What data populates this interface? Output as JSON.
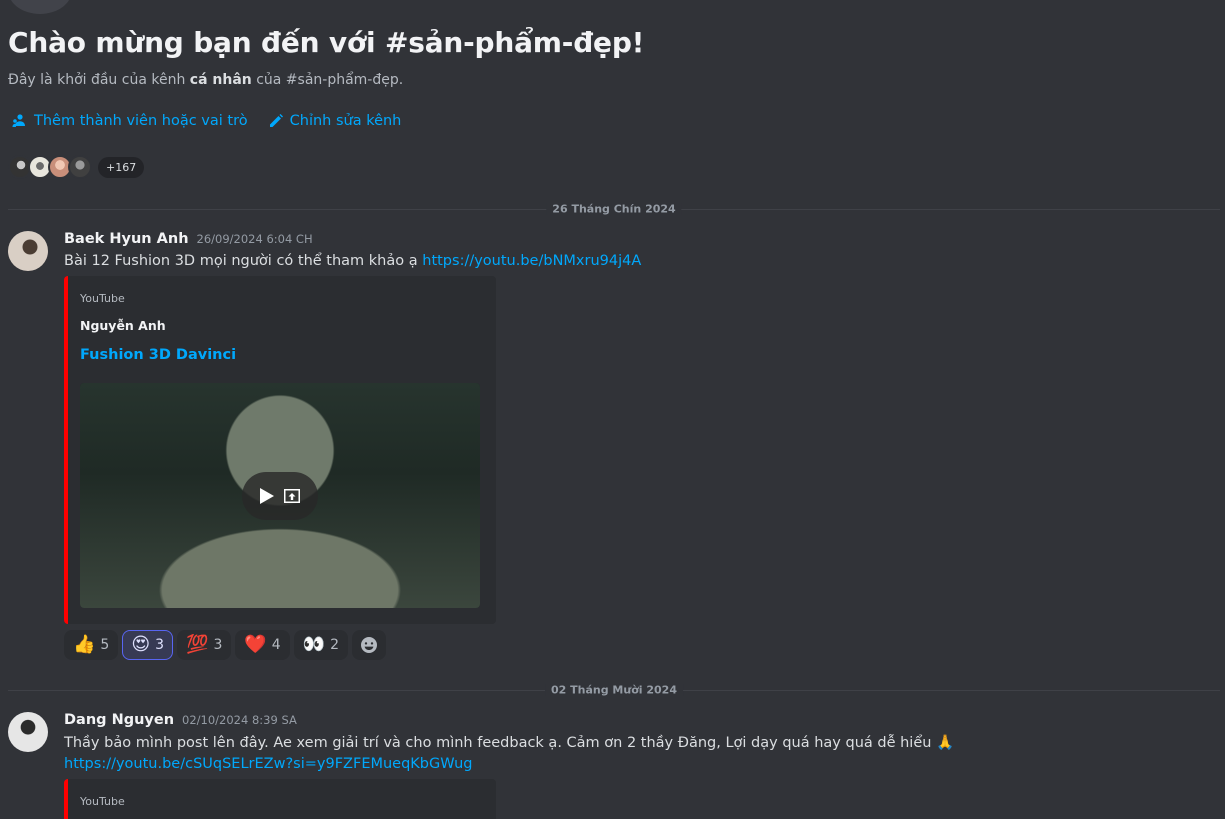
{
  "welcome": {
    "title": "Chào mừng bạn đến với #sản-phẩm-đẹp!",
    "subtitle_before": "Đây là khởi đầu của kênh ",
    "subtitle_bold": "cá nhân",
    "subtitle_after": " của #sản-phẩm-đẹp."
  },
  "actions": {
    "add_members": "Thêm thành viên hoặc vai trò",
    "edit_channel": "Chỉnh sửa kênh"
  },
  "members": {
    "more_count": "+167"
  },
  "dividers": {
    "first": "26 Tháng Chín 2024",
    "second": "02 Tháng Mười 2024"
  },
  "messages": [
    {
      "author": "Baek Hyun Anh",
      "time": "26/09/2024 6:04 CH",
      "text": "Bài 12 Fushion 3D mọi người có thể tham khảo ạ ",
      "link": "https://youtu.be/bNMxru94j4A",
      "embed": {
        "provider": "YouTube",
        "author": "Nguyễn Anh",
        "title": "Fushion 3D Davinci"
      },
      "reactions": [
        {
          "emoji": "👍",
          "count": "5",
          "icon": "thumbs-up-icon"
        },
        {
          "emoji": "😍",
          "count": "3",
          "icon": "heart-eyes-icon",
          "active": true
        },
        {
          "emoji": "💯",
          "count": "3",
          "icon": "hundred-points-icon"
        },
        {
          "emoji": "❤️",
          "count": "4",
          "icon": "red-heart-icon"
        },
        {
          "emoji": "👀",
          "count": "2",
          "icon": "eyes-icon"
        }
      ]
    },
    {
      "author": "Dang Nguyen",
      "time": "02/10/2024 8:39 SA",
      "text": "Thầy bảo mình post lên đây. Ae xem giải trí và cho mình feedback ạ. Cảm ơn 2 thầy Đăng, Lợi  dạy quá hay quá dễ hiểu 🙏",
      "link": "https://youtu.be/cSUqSELrEZw?si=y9FZFEMueqKbGWug",
      "embed": {
        "provider": "YouTube"
      }
    }
  ],
  "colors": {
    "background": "#313338",
    "link": "#00a8fc",
    "embed_border": "#ff0000",
    "active_reaction": "#5865f2"
  }
}
